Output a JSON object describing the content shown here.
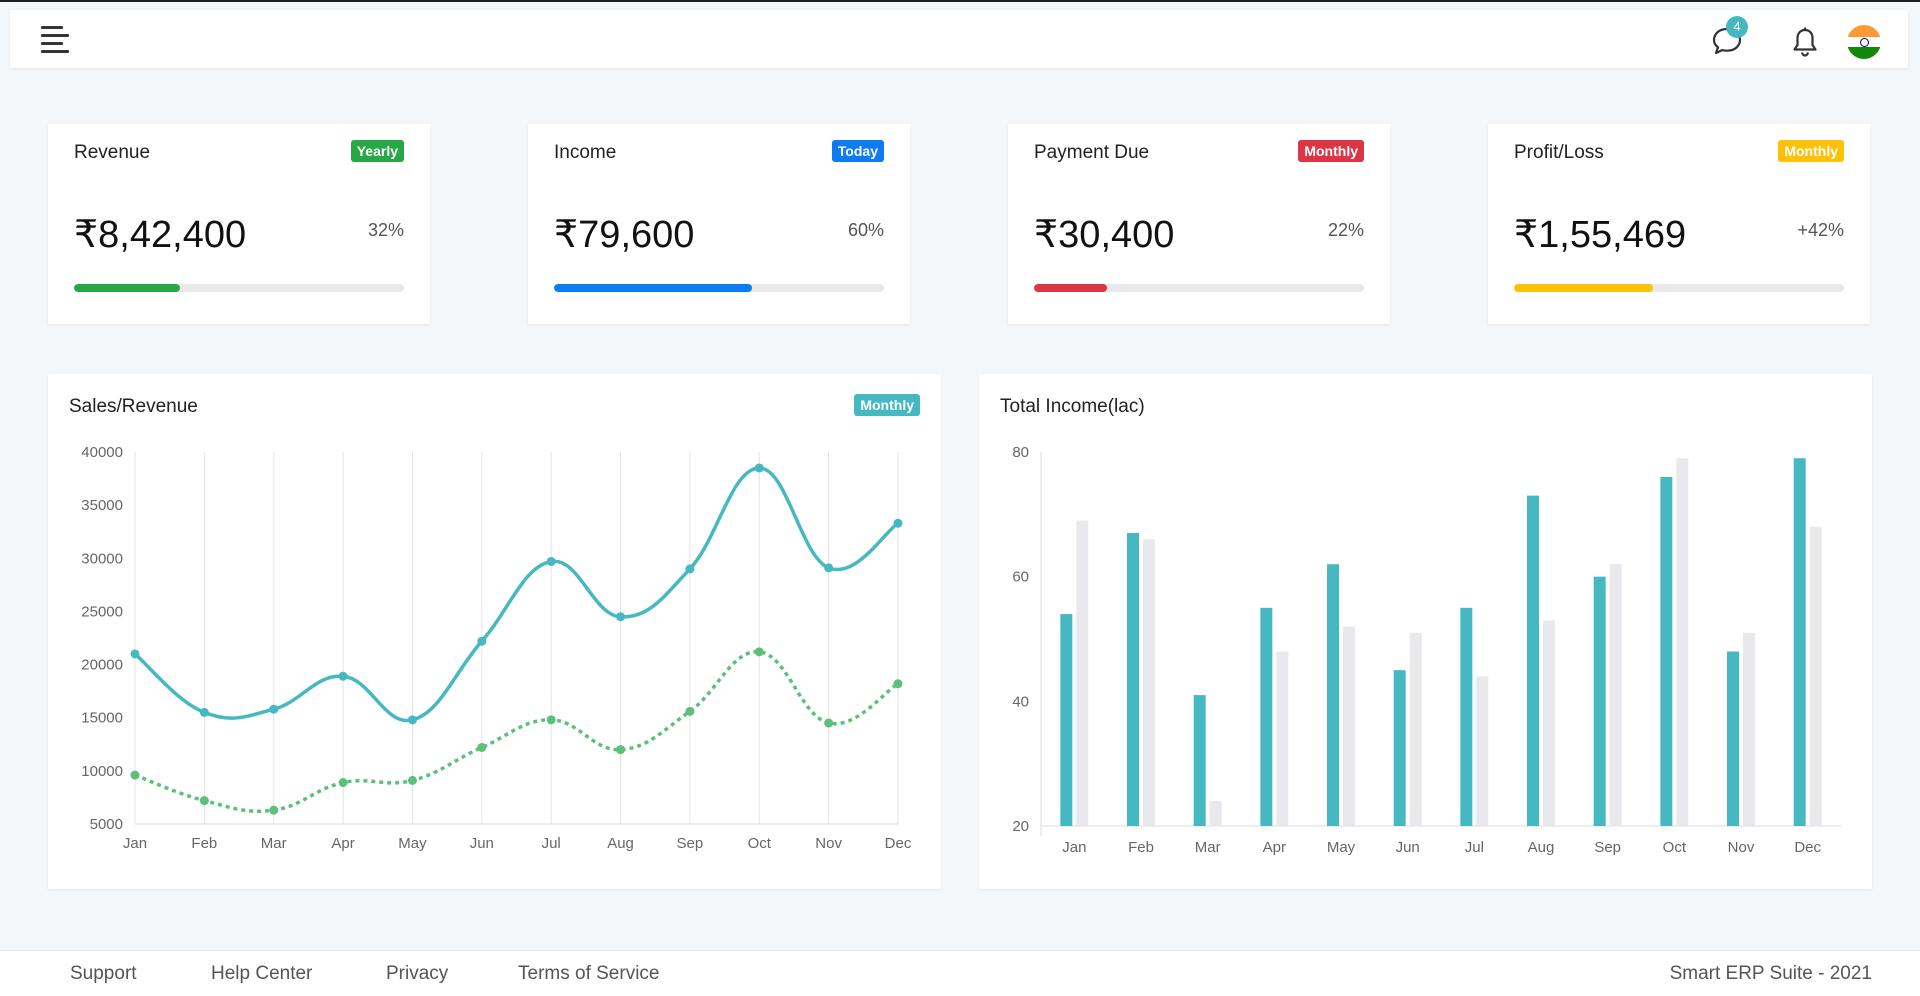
{
  "header": {
    "menu_icon": "hamburger-menu-icon",
    "chat_icon": "chat-bubble-icon",
    "chat_count": "4",
    "bell_icon": "bell-icon",
    "language_flag": "india-flag-icon"
  },
  "stats": [
    {
      "title": "Revenue",
      "badge": "Yearly",
      "badge_color": "#28a745",
      "value": "₹8,42,400",
      "percent_label": "32%",
      "progress": 0.32,
      "progress_color": "#28a745"
    },
    {
      "title": "Income",
      "badge": "Today",
      "badge_color": "#0d7bf2",
      "value": "₹79,600",
      "percent_label": "60%",
      "progress": 0.6,
      "progress_color": "#0d7bf2"
    },
    {
      "title": "Payment Due",
      "badge": "Monthly",
      "badge_color": "#dc3545",
      "value": "₹30,400",
      "percent_label": "22%",
      "progress": 0.22,
      "progress_color": "#dc3545"
    },
    {
      "title": "Profit/Loss",
      "badge": "Monthly",
      "badge_color": "#ffc107",
      "value": "₹1,55,469",
      "percent_label": "+42%",
      "progress": 0.42,
      "progress_color": "#ffc107"
    }
  ],
  "sales_card": {
    "title": "Sales/Revenue",
    "badge": "Monthly",
    "badge_color": "#45b8c2"
  },
  "income_card": {
    "title": "Total Income(lac)"
  },
  "chart_data": [
    {
      "type": "line",
      "title": "Sales/Revenue",
      "categories": [
        "Jan",
        "Feb",
        "Mar",
        "Apr",
        "May",
        "Jun",
        "Jul",
        "Aug",
        "Sep",
        "Oct",
        "Nov",
        "Dec"
      ],
      "yticks": [
        5000,
        10000,
        15000,
        20000,
        25000,
        30000,
        35000,
        40000
      ],
      "ylim": [
        5000,
        40000
      ],
      "grid": "vertical",
      "series": [
        {
          "values": [
            21000,
            15500,
            15800,
            18900,
            14800,
            22200,
            29700,
            24500,
            29000,
            38500,
            29100,
            33300
          ],
          "color": "#45b8c2",
          "style": "solid"
        },
        {
          "values": [
            9600,
            7200,
            6300,
            8900,
            9100,
            12200,
            14800,
            12000,
            15600,
            21200,
            14500,
            18200
          ],
          "color": "#5cc07a",
          "style": "dotted"
        }
      ]
    },
    {
      "type": "bar",
      "title": "Total Income(lac)",
      "categories": [
        "Jan",
        "Feb",
        "Mar",
        "Apr",
        "May",
        "Jun",
        "Jul",
        "Aug",
        "Sep",
        "Oct",
        "Nov",
        "Dec"
      ],
      "yticks": [
        20,
        40,
        60,
        80
      ],
      "ylim": [
        20,
        80
      ],
      "series": [
        {
          "values": [
            54,
            67,
            41,
            55,
            62,
            45,
            55,
            73,
            60,
            76,
            48,
            79
          ],
          "color": "#45b8c2"
        },
        {
          "values": [
            69,
            66,
            24,
            48,
            52,
            51,
            44,
            53,
            62,
            79,
            51,
            68
          ],
          "color": "#e8e8ed"
        }
      ]
    }
  ],
  "footer": {
    "links": [
      "Support",
      "Help Center",
      "Privacy",
      "Terms of Service"
    ],
    "copyright": "Smart ERP Suite - 2021"
  }
}
